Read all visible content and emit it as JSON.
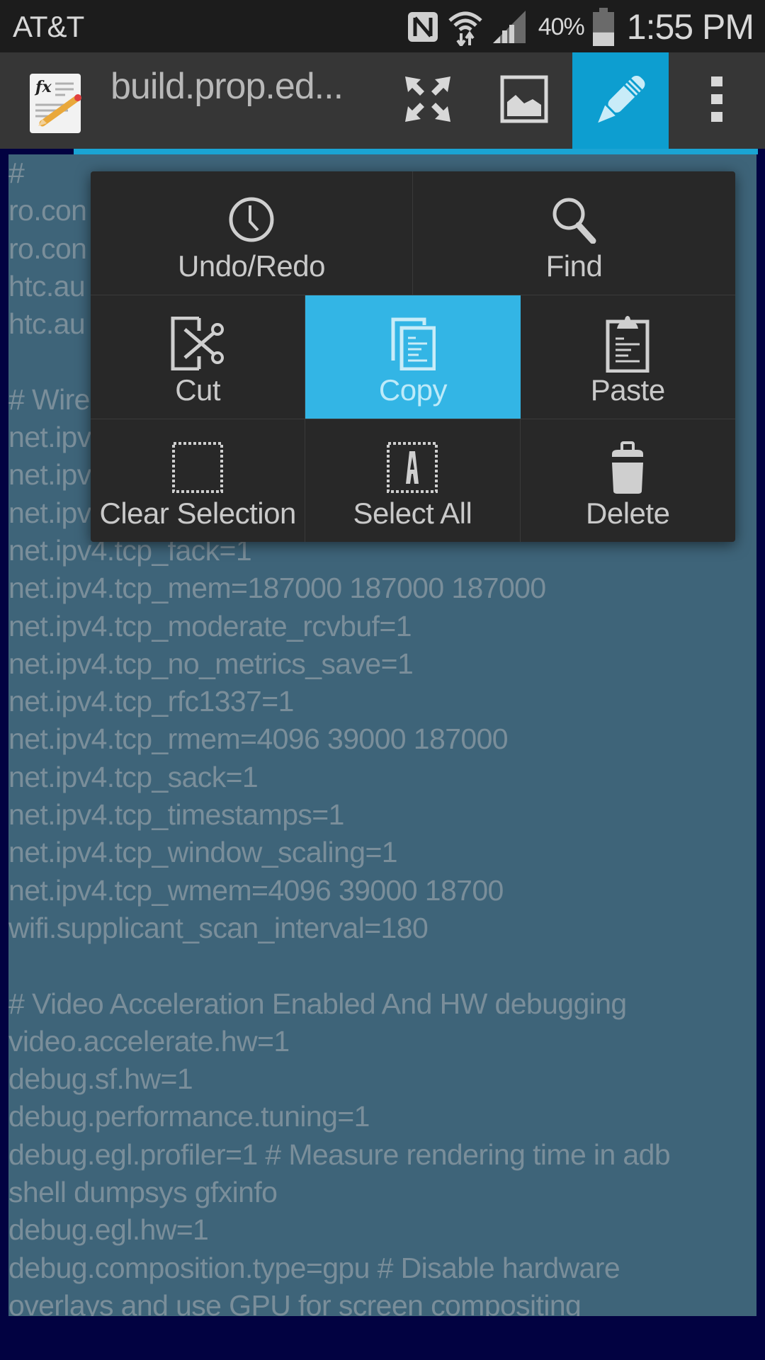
{
  "status_bar": {
    "carrier": "AT&T",
    "battery_percent": "40%",
    "battery_level": 0.4,
    "time": "1:55 PM",
    "icons": [
      "nfc-icon",
      "wifi-icon",
      "signal-icon",
      "battery-icon"
    ]
  },
  "action_bar": {
    "app_icon": "text-editor-app-icon",
    "title": "build.prop.ed...",
    "buttons": [
      {
        "name": "fullscreen",
        "icon": "fullscreen-icon"
      },
      {
        "name": "image",
        "icon": "image-icon"
      },
      {
        "name": "edit",
        "icon": "pencil-icon",
        "active": true
      },
      {
        "name": "overflow",
        "icon": "overflow-menu-icon"
      }
    ]
  },
  "colors": {
    "accent": "#33b5e5",
    "action_bar_active": "#0d9ed0",
    "selection": "#3e6479",
    "editor_background": "#020241",
    "popup_background": "#282828"
  },
  "context_menu": {
    "items": [
      {
        "label": "Undo/Redo",
        "icon": "history-icon"
      },
      {
        "label": "Find",
        "icon": "search-icon"
      },
      {
        "label": "Cut",
        "icon": "cut-icon"
      },
      {
        "label": "Copy",
        "icon": "copy-icon",
        "active": true
      },
      {
        "label": "Paste",
        "icon": "paste-icon"
      },
      {
        "label": "Clear Selection",
        "icon": "clear-selection-icon"
      },
      {
        "label": "Select All",
        "icon": "select-all-icon"
      },
      {
        "label": "Delete",
        "icon": "delete-icon"
      }
    ]
  },
  "editor": {
    "lines": [
      "#",
      "ro.con",
      "ro.con",
      "htc.au",
      "htc.au",
      "",
      "# Wire",
      "net.ipv",
      "net.ipv",
      "net.ipv",
      "net.ipv4.tcp_fack=1",
      "net.ipv4.tcp_mem=187000 187000 187000",
      "net.ipv4.tcp_moderate_rcvbuf=1",
      "net.ipv4.tcp_no_metrics_save=1",
      "net.ipv4.tcp_rfc1337=1",
      "net.ipv4.tcp_rmem=4096 39000 187000",
      "net.ipv4.tcp_sack=1",
      "net.ipv4.tcp_timestamps=1",
      "net.ipv4.tcp_window_scaling=1",
      "net.ipv4.tcp_wmem=4096 39000 18700",
      "wifi.supplicant_scan_interval=180",
      "",
      "# Video Acceleration Enabled And HW debugging",
      "video.accelerate.hw=1",
      "debug.sf.hw=1",
      "debug.performance.tuning=1",
      "debug.egl.profiler=1 # Measure rendering time in adb",
      "shell dumpsys gfxinfo",
      "debug.egl.hw=1",
      "debug.composition.type=gpu # Disable hardware",
      "overlays and use GPU for screen compositing"
    ]
  }
}
